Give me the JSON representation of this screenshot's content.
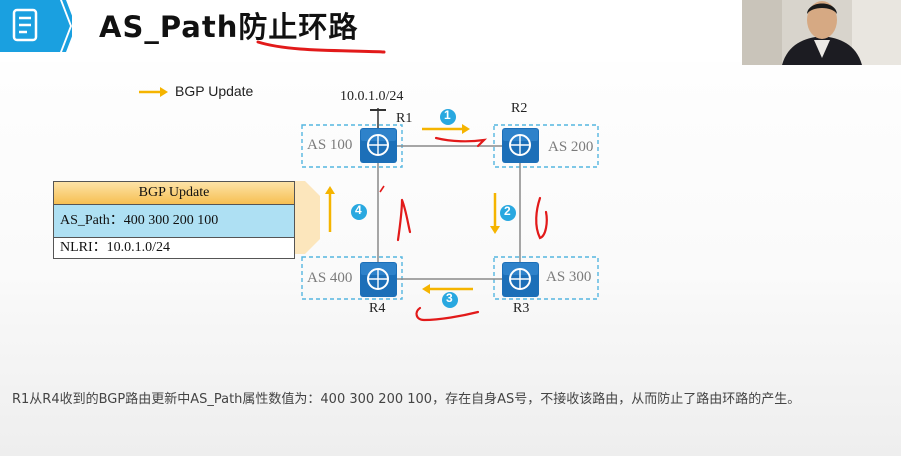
{
  "header": {
    "title": "AS_Path防止环路"
  },
  "legend": {
    "label": "BGP Update",
    "color": "#f5b400"
  },
  "network": {
    "prefix": "10.0.1.0/24",
    "routers": [
      {
        "name": "R1",
        "as": "AS 100"
      },
      {
        "name": "R2",
        "as": "AS 200"
      },
      {
        "name": "R3",
        "as": "AS 300"
      },
      {
        "name": "R4",
        "as": "AS 400"
      }
    ],
    "steps": [
      "1",
      "2",
      "3",
      "4"
    ]
  },
  "update_box": {
    "header": "BGP Update",
    "as_path": "AS_Path：400 300 200 100",
    "nlri": "NLRI：10.0.1.0/24"
  },
  "caption": "R1从R4收到的BGP路由更新中AS_Path属性数值为：400 300 200 100，存在自身AS号，不接收该路由，从而防止了路由环路的产生。",
  "colors": {
    "router": "#1c6fb8",
    "as_border": "#55b6e0",
    "arrow": "#f5b400",
    "step_badge": "#29a8e0",
    "annotation": "#e21a1a",
    "brand": "#1aa0e0"
  },
  "icons": [
    "document-icon",
    "router-icon",
    "webcam-presenter"
  ]
}
